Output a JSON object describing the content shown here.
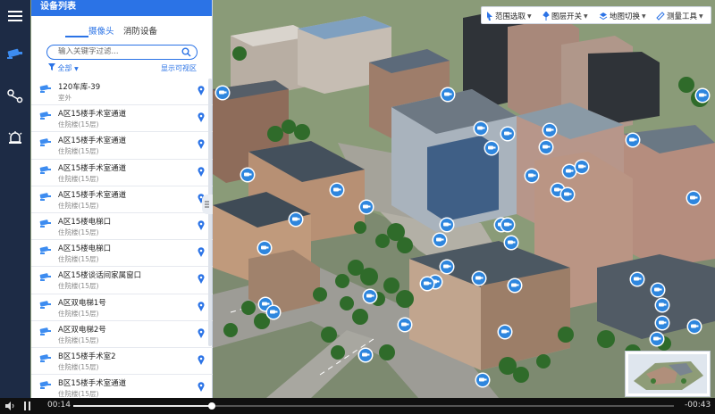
{
  "panel": {
    "title": "设备列表",
    "tabs": [
      {
        "label": "摄像头",
        "active": true
      },
      {
        "label": "消防设备",
        "active": false
      }
    ],
    "search_placeholder": "输入关键字过滤...",
    "filter_label": "全部",
    "filter_right": "显示可视区",
    "devices": [
      {
        "name": "120车库-39",
        "sub": "室外"
      },
      {
        "name": "A区15楼手术室通道",
        "sub": "住院楼(15层)"
      },
      {
        "name": "A区15楼手术室通道",
        "sub": "住院楼(15层)"
      },
      {
        "name": "A区15楼手术室通道",
        "sub": "住院楼(15层)"
      },
      {
        "name": "A区15楼手术室通道",
        "sub": "住院楼(15层)"
      },
      {
        "name": "A区15楼电梯口",
        "sub": "住院楼(15层)"
      },
      {
        "name": "A区15楼电梯口",
        "sub": "住院楼(15层)"
      },
      {
        "name": "A区15楼谈话间家属窗口",
        "sub": "住院楼(15层)"
      },
      {
        "name": "A区双电梯1号",
        "sub": "住院楼(15层)"
      },
      {
        "name": "A区双电梯2号",
        "sub": "住院楼(15层)"
      },
      {
        "name": "B区15楼手术室2",
        "sub": "住院楼(15层)"
      },
      {
        "name": "B区15楼手术室通道",
        "sub": "住院楼(15层)"
      }
    ]
  },
  "toolbar": {
    "range_select": "范围选取",
    "layer_toggle": "图层开关",
    "map_switch": "地图切换",
    "measure_tools": "测量工具"
  },
  "video": {
    "current_time": "00:14",
    "remaining_time": "-00:43",
    "progress": 0.23
  },
  "colors": {
    "accent": "#2b73e6",
    "rail": "#1d2b45",
    "marker": "#2e86de"
  }
}
